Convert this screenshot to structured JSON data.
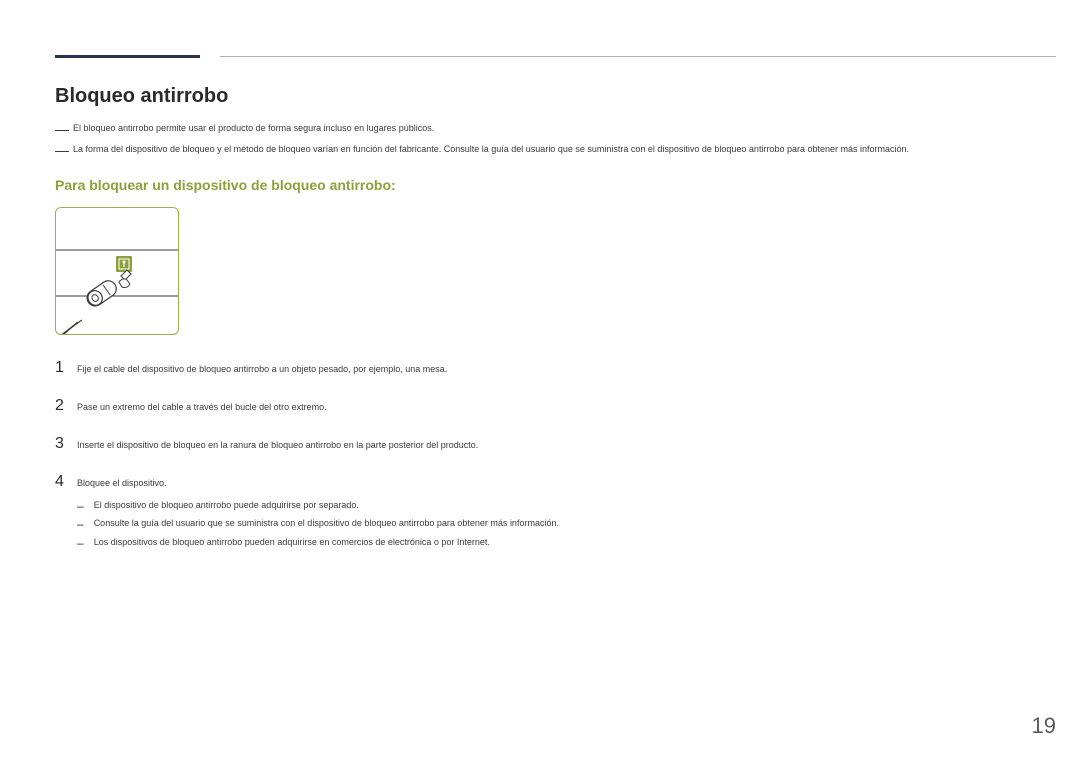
{
  "heading": "Bloqueo antirrobo",
  "notes": [
    "El bloqueo antirrobo permite usar el producto de forma segura incluso en lugares públicos.",
    "La forma del dispositivo de bloqueo y el método de bloqueo varían en función del fabricante. Consulte la guía del usuario que se suministra con el dispositivo de bloqueo antirrobo para obtener más información."
  ],
  "sub_heading": "Para bloquear un dispositivo de bloqueo antirrobo:",
  "steps": [
    {
      "num": "1",
      "text": "Fije el cable del dispositivo de bloqueo antirrobo a un objeto pesado, por ejemplo, una mesa."
    },
    {
      "num": "2",
      "text": "Pase un extremo del cable a través del bucle del otro extremo."
    },
    {
      "num": "3",
      "text": "Inserte el dispositivo de bloqueo en la ranura de bloqueo antirrobo en la parte posterior del producto."
    },
    {
      "num": "4",
      "text": "Bloquee el dispositivo."
    }
  ],
  "sub_notes": [
    "El dispositivo de bloqueo antirrobo puede adquirirse por separado.",
    "Consulte la guía del usuario que se suministra con el dispositivo de bloqueo antirrobo para obtener más información.",
    "Los dispositivos de bloqueo antirrobo pueden adquirirse en comercios de electrónica o por Internet."
  ],
  "page_number": "19"
}
